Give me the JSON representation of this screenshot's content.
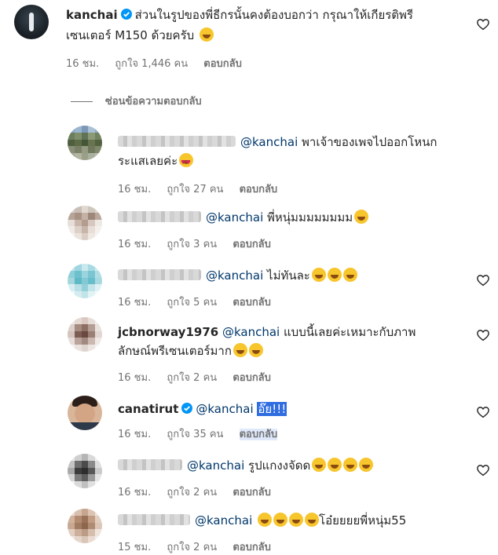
{
  "main_comment": {
    "username": "kanchai",
    "text_line1": "ส่วนในรูปของพี่ธีกรนั้นคงต้องบอกว่า กรุณาให้เกียรติพรี",
    "text_line2": "เซนเตอร์ M150 ด้วยครับ",
    "time": "16 ชม.",
    "likes": "ถูกใจ 1,446 คน",
    "reply_label": "ตอบกลับ"
  },
  "hide_replies_label": "ซ่อนข้อความตอบกลับ",
  "replies": [
    {
      "username": "",
      "mention": "@kanchai",
      "text_line1": "พาเจ้าของเพจไปออกโหนก",
      "text_line2": "ระแสเลยค่ะ",
      "time": "16 ชม.",
      "likes": "ถูกใจ 27 คน",
      "reply_label": "ตอบกลับ"
    },
    {
      "username": "",
      "mention": "@kanchai",
      "text_line1": "พี่หนุ่มมมมมมมม",
      "time": "16 ชม.",
      "likes": "ถูกใจ 3 คน",
      "reply_label": "ตอบกลับ"
    },
    {
      "username": "",
      "mention": "@kanchai",
      "text_line1": "ไม่ทันละ",
      "time": "16 ชม.",
      "likes": "ถูกใจ 5 คน",
      "reply_label": "ตอบกลับ"
    },
    {
      "username": "jcbnorway1976",
      "mention": "@kanchai",
      "text_line1": "แบบนี้เลยค่ะเหมาะกับภาพ",
      "text_line2": "ลักษณ์พรีเซนเตอร์มาก",
      "time": "16 ชม.",
      "likes": "ถูกใจ 2 คน",
      "reply_label": "ตอบกลับ"
    },
    {
      "username": "canatirut",
      "mention": "@kanchai",
      "text_line1": "อ๊ย!!!",
      "time": "16 ชม.",
      "likes": "ถูกใจ 35 คน",
      "reply_label": "ตอบกลับ"
    },
    {
      "username": "",
      "mention": "@kanchai",
      "text_line1": "รูปแกงงจัดด",
      "time": "16 ชม.",
      "likes": "ถูกใจ 2 คน",
      "reply_label": "ตอบกลับ"
    },
    {
      "username": "",
      "mention": "@kanchai",
      "text_line1": "โอ๋ยยยยพี่หนุ่ม55",
      "time": "15 ชม.",
      "likes": "ถูกใจ 2 คน",
      "reply_label": "ตอบกลับ"
    }
  ],
  "colors": {
    "mention": "#00376b",
    "verified": "#0095f6",
    "meta": "#737373",
    "selection": "#2f6de1"
  },
  "icons": {
    "like": "heart-outline-icon",
    "verified": "verified-badge-icon"
  }
}
